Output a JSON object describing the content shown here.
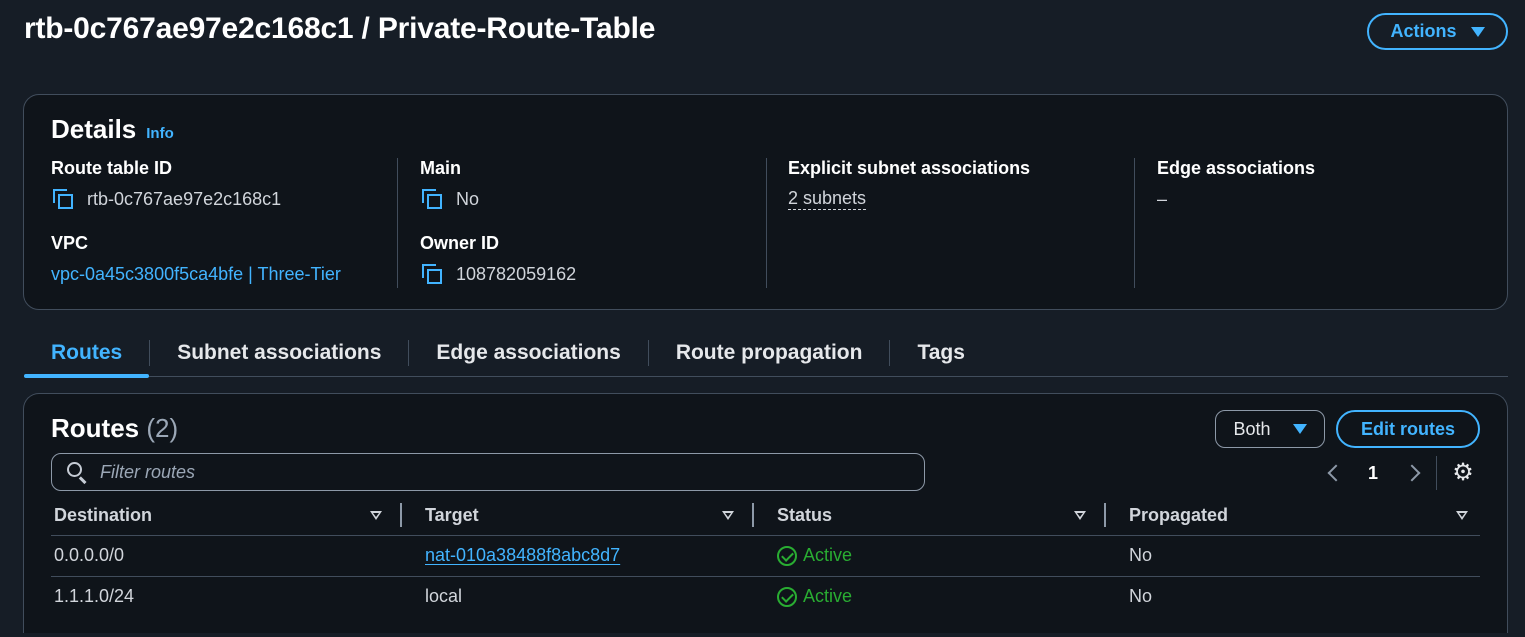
{
  "page": {
    "title": "rtb-0c767ae97e2c168c1 / Private-Route-Table",
    "actions_label": "Actions"
  },
  "details": {
    "heading": "Details",
    "info": "Info",
    "route_table_id": {
      "label": "Route table ID",
      "value": "rtb-0c767ae97e2c168c1"
    },
    "vpc": {
      "label": "VPC",
      "value": "vpc-0a45c3800f5ca4bfe | Three-Tier"
    },
    "main": {
      "label": "Main",
      "value": "No"
    },
    "owner_id": {
      "label": "Owner ID",
      "value": "108782059162"
    },
    "explicit_subnets": {
      "label": "Explicit subnet associations",
      "value": "2 subnets"
    },
    "edge": {
      "label": "Edge associations",
      "value": "–"
    }
  },
  "tabs": [
    {
      "label": "Routes",
      "active": true
    },
    {
      "label": "Subnet associations"
    },
    {
      "label": "Edge associations"
    },
    {
      "label": "Route propagation"
    },
    {
      "label": "Tags"
    }
  ],
  "routes": {
    "heading": "Routes",
    "count": "(2)",
    "filter_select": "Both",
    "edit_label": "Edit routes",
    "search_placeholder": "Filter routes",
    "page": "1",
    "columns": [
      "Destination",
      "Target",
      "Status",
      "Propagated"
    ],
    "rows": [
      {
        "destination": "0.0.0.0/0",
        "target": "nat-010a38488f8abc8d7",
        "target_link": true,
        "status": "Active",
        "propagated": "No"
      },
      {
        "destination": "1.1.1.0/24",
        "target": "local",
        "target_link": false,
        "status": "Active",
        "propagated": "No"
      }
    ]
  },
  "colors": {
    "accent": "#42b4ff",
    "success": "#29ad32",
    "background": "#161d26",
    "panel": "#0f141a"
  },
  "icons": [
    "copy-icon",
    "search-icon",
    "chevron-left-icon",
    "chevron-right-icon",
    "gear-icon",
    "check-circle-icon",
    "caret-down-icon",
    "sort-icon"
  ]
}
